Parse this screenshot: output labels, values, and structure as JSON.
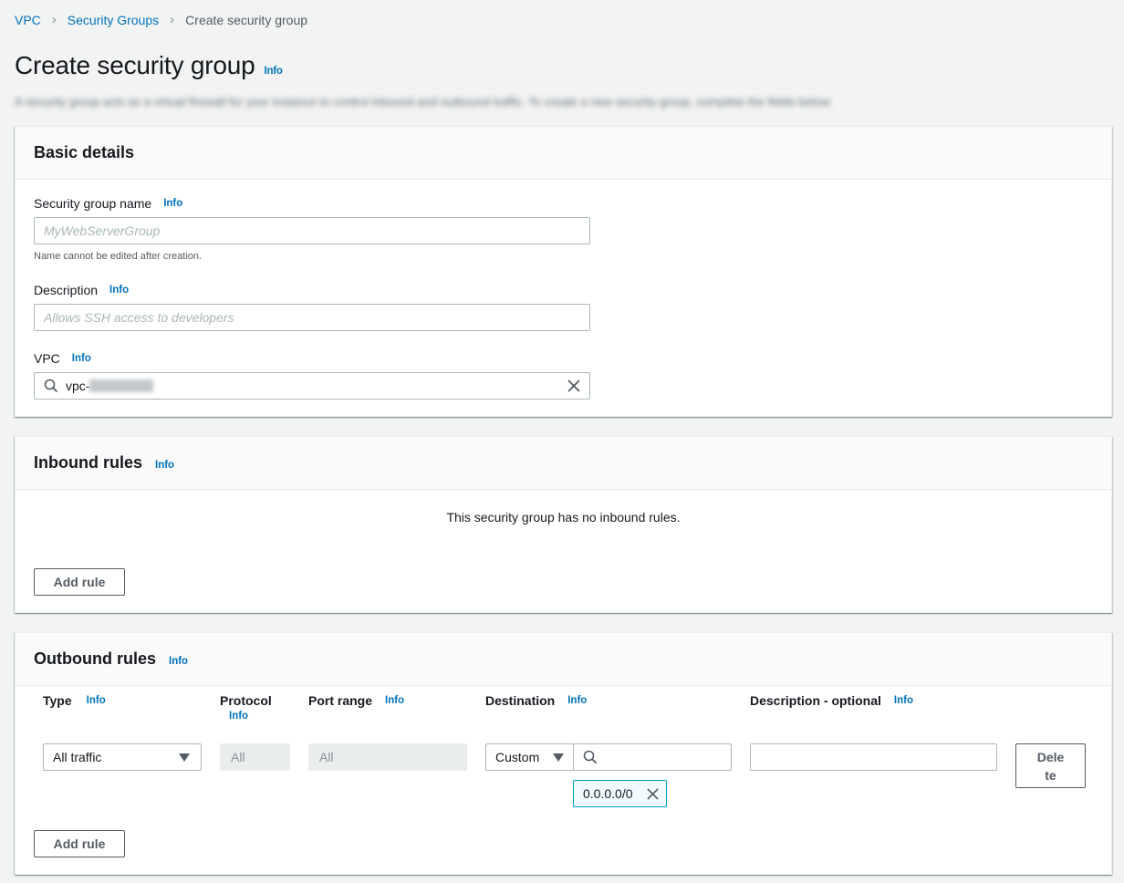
{
  "breadcrumb": {
    "items": [
      "VPC",
      "Security Groups"
    ],
    "current": "Create security group"
  },
  "page": {
    "title": "Create security group",
    "info": "Info",
    "description": "A security group acts as a virtual firewall for your instance to control inbound and outbound traffic. To create a new security group, complete the fields below."
  },
  "basic": {
    "title": "Basic details",
    "name_label": "Security group name",
    "name_info": "Info",
    "name_placeholder": "MyWebServerGroup",
    "name_hint": "Name cannot be edited after creation.",
    "desc_label": "Description",
    "desc_info": "Info",
    "desc_placeholder": "Allows SSH access to developers",
    "vpc_label": "VPC",
    "vpc_info": "Info",
    "vpc_value": "vpc-"
  },
  "inbound": {
    "title": "Inbound rules",
    "info": "Info",
    "empty": "This security group has no inbound rules.",
    "add_rule": "Add rule"
  },
  "outbound": {
    "title": "Outbound rules",
    "info": "Info",
    "columns": {
      "type": "Type",
      "type_info": "Info",
      "protocol": "Protocol",
      "protocol_info": "Info",
      "port": "Port range",
      "port_info": "Info",
      "destination": "Destination",
      "destination_info": "Info",
      "description": "Description - optional",
      "description_info": "Info"
    },
    "row": {
      "type": "All traffic",
      "protocol": "All",
      "port": "All",
      "destination": "Custom",
      "cidr_token": "0.0.0.0/0",
      "delete_1": "Dele",
      "delete_2": "te"
    },
    "add_rule": "Add rule"
  },
  "colors": {
    "link": "#0073bb",
    "background": "#f2f3f3",
    "border": "#aab7b8"
  }
}
